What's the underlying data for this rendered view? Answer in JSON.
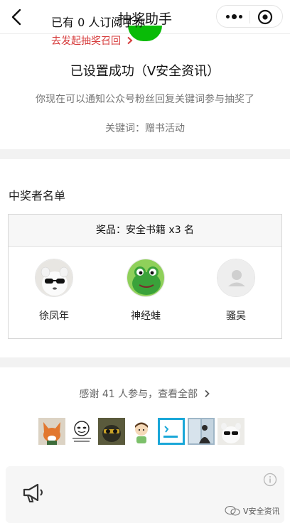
{
  "nav": {
    "title": "抽奖助手"
  },
  "status": {
    "title": "已设置成功（V安全资讯）",
    "description": "你现在可以通知公众号粉丝回复关键词参与抽奖了",
    "keyword_label": "关键词：",
    "keyword_value": "赠书活动"
  },
  "winners": {
    "heading": "中奖者名单",
    "prize_label": "奖品：",
    "prize_name": "安全书籍 x3 名",
    "list": [
      {
        "name": "徐凤年",
        "avatar": "panda-sunglasses-avatar"
      },
      {
        "name": "神经蛙",
        "avatar": "frog-avatar"
      },
      {
        "name": "骚吴",
        "avatar": "default-user-avatar"
      }
    ]
  },
  "participants": {
    "thanks_text": "感谢 41 人参与，查看全部",
    "avatars": [
      "fox-avatar",
      "meme-avatar",
      "sunglasses-cat-avatar",
      "cartoon-boy-avatar",
      "blue-card-avatar",
      "window-figure-avatar",
      "panda-sunglasses-avatar"
    ]
  },
  "subscription": {
    "count_text": "已有 0 人订阅了你",
    "link_text": "去发起抽奖召回"
  },
  "watermark": {
    "text": "V安全资讯"
  },
  "colors": {
    "accent_green": "#09bb07",
    "link_red": "#d63b3b",
    "frog_green": "#3aa23a"
  }
}
